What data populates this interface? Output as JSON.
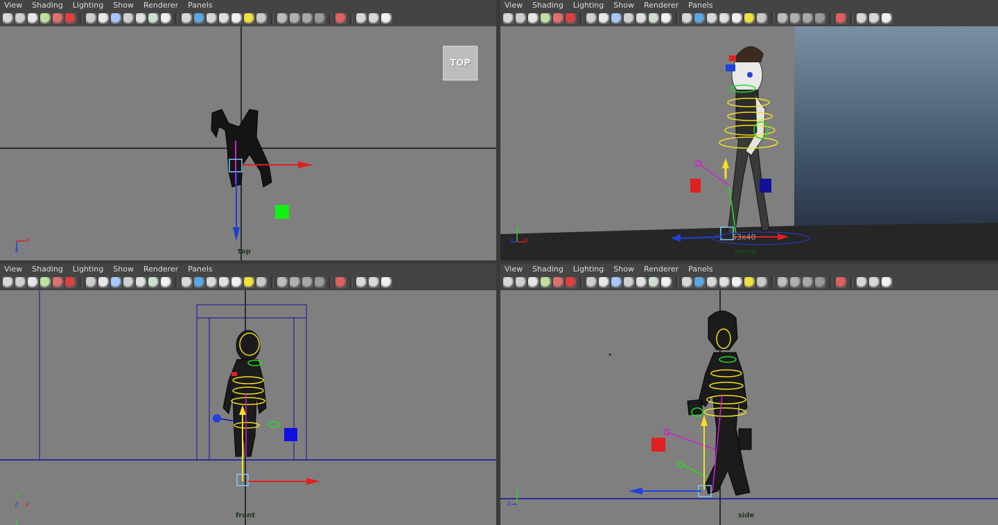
{
  "menu": [
    "View",
    "Shading",
    "Lighting",
    "Show",
    "Renderer",
    "Panels"
  ],
  "toolbar_icons": [
    {
      "name": "camera-select-icon",
      "color": "#d8d8d8"
    },
    {
      "name": "camera-attributes-icon",
      "color": "#cfcfcf"
    },
    {
      "name": "bookmarks-icon",
      "color": "#e6e6e6"
    },
    {
      "name": "image-plane-icon",
      "color": "#bfe0a0"
    },
    {
      "name": "2d-pan-zoom-icon",
      "color": "#e07070"
    },
    {
      "name": "grease-pencil-icon",
      "color": "#e04040"
    },
    {
      "sep": true
    },
    {
      "name": "wireframe-icon",
      "color": "#cfcfcf"
    },
    {
      "name": "grid-icon",
      "color": "#e8e8e8"
    },
    {
      "name": "film-gate-icon",
      "color": "#a8c8ff"
    },
    {
      "name": "resolution-gate-icon",
      "color": "#d0d0d0"
    },
    {
      "name": "gate-mask-icon",
      "color": "#e0e0e0"
    },
    {
      "name": "field-chart-icon",
      "color": "#cde0cd"
    },
    {
      "name": "safe-title-icon",
      "color": "#f0f0f0"
    },
    {
      "sep": true
    },
    {
      "name": "wireframe-shading-icon",
      "color": "#d8d8d8"
    },
    {
      "name": "smooth-shade-icon",
      "color": "#5da7e0"
    },
    {
      "name": "wireframe-on-shaded-icon",
      "color": "#d8d8d8"
    },
    {
      "name": "xray-icon",
      "color": "#e0e0e0"
    },
    {
      "name": "textured-icon",
      "color": "#f0f0f0"
    },
    {
      "name": "lights-icon",
      "color": "#f0e040"
    },
    {
      "name": "shadows-icon",
      "color": "#c8c8c8"
    },
    {
      "sep": true
    },
    {
      "name": "screen-space-ao-icon",
      "color": "#bdbdbd"
    },
    {
      "name": "motion-blur-icon",
      "color": "#b0b0b0"
    },
    {
      "name": "anti-aliasing-icon",
      "color": "#a8a8a8"
    },
    {
      "name": "depth-of-field-icon",
      "color": "#9a9a9a"
    },
    {
      "sep": true
    },
    {
      "name": "isolate-select-icon",
      "color": "#e06060"
    },
    {
      "sep": true
    },
    {
      "name": "xray-joints-icon",
      "color": "#d8d8d8"
    },
    {
      "name": "xray-active-icon",
      "color": "#d8d8d8"
    },
    {
      "name": "share-icon",
      "color": "#f0f0f0"
    }
  ],
  "panels": [
    {
      "id": "top",
      "camera_label": "top",
      "viewcube": "TOP"
    },
    {
      "id": "persp",
      "camera_label": "persp",
      "badge": "53x40"
    },
    {
      "id": "front",
      "camera_label": "front"
    },
    {
      "id": "side",
      "camera_label": "side"
    }
  ],
  "axis_labels": {
    "x": "x",
    "y": "y",
    "z": "z"
  },
  "colors": {
    "viewport_bg": "#7f7f7f",
    "panel_chrome": "#444444",
    "menu_text": "#dcdcdc",
    "axis_x": "#e03030",
    "axis_y": "#30d030",
    "axis_z": "#3030e0",
    "controller_yellow": "#f5e01e",
    "controller_green": "#20e020",
    "controller_magenta": "#d020d0"
  }
}
